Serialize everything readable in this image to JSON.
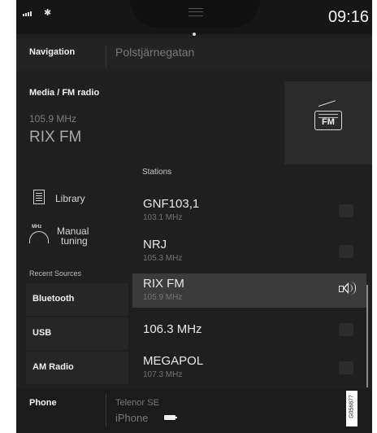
{
  "status_bar": {
    "time": "09:16",
    "signal_icon": "signal-bars-icon",
    "bluetooth_icon": "bluetooth-icon"
  },
  "navigation": {
    "label": "Navigation",
    "destination": "Polstjärnegatan"
  },
  "media": {
    "label": "Media / FM radio",
    "frequency": "105.9 MHz",
    "station": "RIX FM",
    "source_icon": "fm-radio-icon",
    "source_icon_text": "FM"
  },
  "library": {
    "label": "Library",
    "icon": "library-list-icon"
  },
  "manual_tuning": {
    "label_line1": "Manual",
    "label_line2": "tuning",
    "icon_text": "MHz",
    "icon": "manual-tuning-icon"
  },
  "recent_sources": {
    "label": "Recent Sources",
    "items": [
      {
        "label": "Bluetooth"
      },
      {
        "label": "USB"
      },
      {
        "label": "AM Radio"
      }
    ]
  },
  "stations": {
    "label": "Stations",
    "items": [
      {
        "name": "GNF103,1",
        "frequency": "103.1 MHz",
        "active": false
      },
      {
        "name": "NRJ",
        "frequency": "105.3 MHz",
        "active": false
      },
      {
        "name": "RIX FM",
        "frequency": "105.9 MHz",
        "active": true
      },
      {
        "name": "106.3 MHz",
        "frequency": "",
        "active": false
      },
      {
        "name": "MEGAPOL",
        "frequency": "107.3 MHz",
        "active": false
      }
    ]
  },
  "phone": {
    "label": "Phone",
    "carrier": "Telenor SE",
    "device": "iPhone"
  },
  "figure_code": "G056877",
  "colors": {
    "background": "#1f1f1f",
    "tile": "#262626",
    "active_row": "#3b3b3b",
    "text": "#eaeaea",
    "muted_text": "#7a7a7a"
  }
}
